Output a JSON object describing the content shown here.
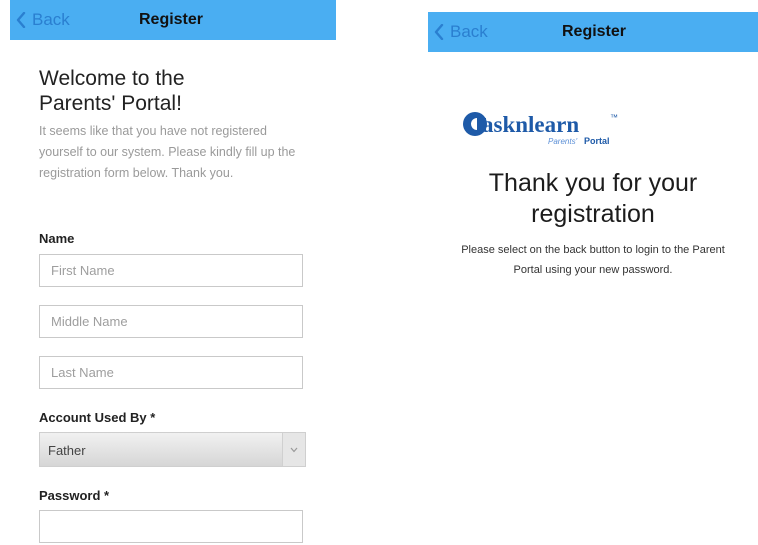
{
  "left": {
    "nav": {
      "back_label": "Back",
      "title": "Register"
    },
    "welcome": {
      "title_line1": "Welcome to the",
      "title_line2": "Parents' Portal!",
      "text": "It seems like that you have not registered yourself to our system. Please kindly fill up the registration form below. Thank you."
    },
    "form": {
      "name_label": "Name",
      "first_name_placeholder": "First Name",
      "middle_name_placeholder": "Middle Name",
      "last_name_placeholder": "Last Name",
      "account_label": "Account Used By *",
      "account_value": "Father",
      "password_label": "Password *",
      "password_value": ""
    }
  },
  "right": {
    "nav": {
      "back_label": "Back",
      "title": "Register"
    },
    "logo": {
      "brand": "asknlearn",
      "tm": "™",
      "sub1": "Parents'",
      "sub2": "Portal"
    },
    "thanks": {
      "title_line1": "Thank you for your",
      "title_line2": "registration",
      "text": "Please select on the back button to login to the Parent Portal using your new password."
    }
  },
  "colors": {
    "navbar": "#4aaef2",
    "back_link": "#2a7fd0",
    "logo_blue": "#1e5aa8"
  },
  "icons": {
    "back": "chevron-left-icon",
    "select": "chevron-down-icon"
  }
}
